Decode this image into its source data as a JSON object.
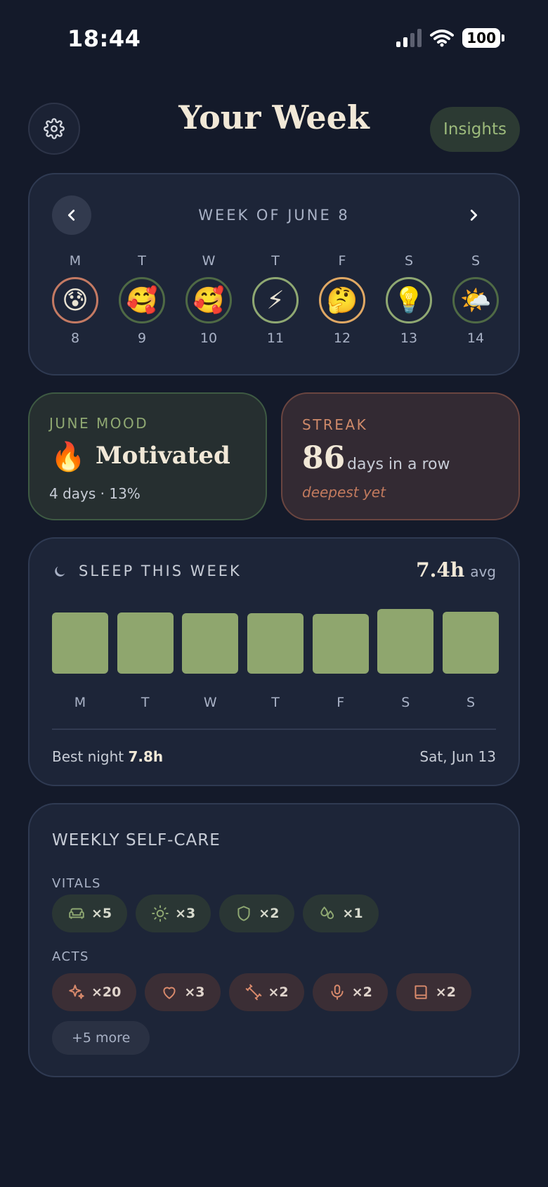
{
  "status": {
    "time": "18:44",
    "battery": "100"
  },
  "header": {
    "title": "Your Week",
    "insights_label": "Insights"
  },
  "week": {
    "label": "WEEK OF JUNE 8",
    "days": [
      {
        "letter": "M",
        "emoji": "😰",
        "num": "8",
        "ring": "#c47a63"
      },
      {
        "letter": "T",
        "emoji": "🥰",
        "num": "9",
        "ring": "#4f6a45"
      },
      {
        "letter": "W",
        "emoji": "🥰",
        "num": "10",
        "ring": "#4f6a45"
      },
      {
        "letter": "T",
        "emoji": "⚡",
        "num": "11",
        "ring": "#8fa872"
      },
      {
        "letter": "F",
        "emoji": "🤔",
        "num": "12",
        "ring": "#e0a864"
      },
      {
        "letter": "S",
        "emoji": "💡",
        "num": "13",
        "ring": "#8fa872"
      },
      {
        "letter": "S",
        "emoji": "🌤️",
        "num": "14",
        "ring": "#4f6a45"
      }
    ]
  },
  "mood": {
    "label": "JUNE MOOD",
    "emoji": "🔥",
    "name": "Motivated",
    "sub": "4 days · 13%"
  },
  "streak": {
    "label": "STREAK",
    "count": "86",
    "unit": "days in a row",
    "note": "deepest yet"
  },
  "sleep": {
    "title": "SLEEP THIS WEEK",
    "avg_value": "7.4h",
    "avg_unit": "avg",
    "best_label": "Best night",
    "best_value": "7.8h",
    "best_date": "Sat, Jun 13",
    "chart_data": {
      "type": "bar",
      "categories": [
        "M",
        "T",
        "W",
        "T",
        "F",
        "S",
        "S"
      ],
      "values": [
        7.4,
        7.4,
        7.3,
        7.3,
        7.2,
        7.8,
        7.5
      ],
      "ylim": [
        0,
        7.8
      ]
    }
  },
  "selfcare": {
    "title": "WEEKLY SELF-CARE",
    "vitals_label": "VITALS",
    "vitals": [
      {
        "icon": "sofa-icon",
        "count": "×5"
      },
      {
        "icon": "sun-icon",
        "count": "×3"
      },
      {
        "icon": "shield-icon",
        "count": "×2"
      },
      {
        "icon": "drops-icon",
        "count": "×1"
      }
    ],
    "acts_label": "ACTS",
    "acts": [
      {
        "icon": "sparkles-icon",
        "count": "×20"
      },
      {
        "icon": "heart-icon",
        "count": "×3"
      },
      {
        "icon": "dumbbell-icon",
        "count": "×2"
      },
      {
        "icon": "microphone-icon",
        "count": "×2"
      },
      {
        "icon": "book-icon",
        "count": "×2"
      }
    ],
    "more_label": "+5 more"
  },
  "colors": {
    "vital_icon": "#8fa872",
    "act_icon": "#d98a6c",
    "bar": "#8fa66e"
  }
}
